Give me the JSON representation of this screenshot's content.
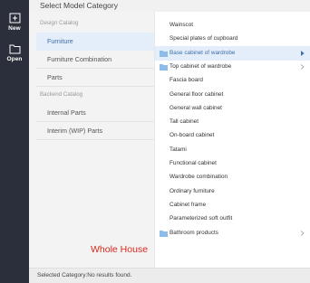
{
  "rail": {
    "new_label": "New",
    "open_label": "Open"
  },
  "header": {
    "title": "Select Model Category"
  },
  "left_panel": {
    "design_catalog_title": "Design Catalog",
    "design_items": [
      "Furniture",
      "Furniture Combination",
      "Parts"
    ],
    "backend_catalog_title": "Backend Catalog",
    "backend_items": [
      "Internal Parts",
      "Interim (WIP) Parts"
    ],
    "selected_item": "Furniture",
    "whole_house_label": "Whole House"
  },
  "right_panel": {
    "items": [
      {
        "label": "Wainscot",
        "folder": false,
        "expandable": false,
        "selected": false
      },
      {
        "label": "Special plates of cupboard",
        "folder": false,
        "expandable": false,
        "selected": false
      },
      {
        "label": "Base cabinet of wardrobe",
        "folder": true,
        "expandable": true,
        "selected": true
      },
      {
        "label": "Top cabinet of wardrobe",
        "folder": true,
        "expandable": true,
        "selected": false
      },
      {
        "label": "Fascia board",
        "folder": false,
        "expandable": false,
        "selected": false
      },
      {
        "label": "General floor cabinet",
        "folder": false,
        "expandable": false,
        "selected": false
      },
      {
        "label": "General wall cabinet",
        "folder": false,
        "expandable": false,
        "selected": false
      },
      {
        "label": "Tall cabinet",
        "folder": false,
        "expandable": false,
        "selected": false
      },
      {
        "label": "On-board cabinet",
        "folder": false,
        "expandable": false,
        "selected": false
      },
      {
        "label": "Tatami",
        "folder": false,
        "expandable": false,
        "selected": false
      },
      {
        "label": "Functional cabinet",
        "folder": false,
        "expandable": false,
        "selected": false
      },
      {
        "label": "Wardrobe combination",
        "folder": false,
        "expandable": false,
        "selected": false
      },
      {
        "label": "Ordinary furniture",
        "folder": false,
        "expandable": false,
        "selected": false
      },
      {
        "label": "Cabinet frame",
        "folder": false,
        "expandable": false,
        "selected": false
      },
      {
        "label": "Parameterized soft outfit",
        "folder": false,
        "expandable": false,
        "selected": false
      },
      {
        "label": "Bathroom products",
        "folder": true,
        "expandable": true,
        "selected": false
      }
    ]
  },
  "status_bar": {
    "message": "Selected Category:No results found."
  },
  "colors": {
    "rail_bg": "#2b2e3b",
    "accent": "#3e6fa8",
    "selection_bg": "#e3eefa",
    "whole_house": "#d8281c",
    "folder": "#8fbbe8"
  }
}
